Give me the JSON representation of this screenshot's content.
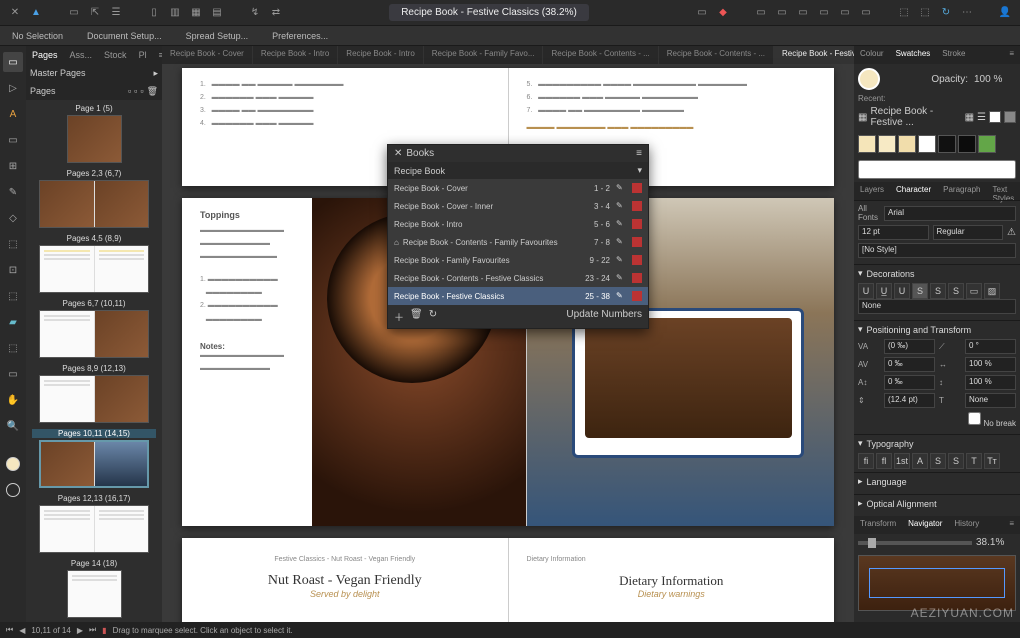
{
  "toolbar": {
    "doc_title": "Recipe Book - Festive Classics (38.2%)"
  },
  "menubar": {
    "items": [
      "No Selection",
      "Document Setup...",
      "Spread Setup...",
      "Preferences..."
    ]
  },
  "pages_panel": {
    "tabs": [
      "Pages",
      "Ass...",
      "Stock",
      "Pl"
    ],
    "section1": "Master Pages",
    "section2": "Pages",
    "list": [
      {
        "label": "Page 1 (5)"
      },
      {
        "label": "Pages 2,3 (6,7)"
      },
      {
        "label": "Pages 4,5 (8,9)"
      },
      {
        "label": "Pages 6,7 (10,11)"
      },
      {
        "label": "Pages 8,9 (12,13)"
      },
      {
        "label": "Pages 10,11 (14,15)"
      },
      {
        "label": "Pages 12,13 (16,17)"
      },
      {
        "label": "Page 14 (18)"
      }
    ]
  },
  "spread_tabs": [
    "Recipe Book - Cover",
    "Recipe Book - Intro",
    "Recipe Book - Intro",
    "Recipe Book - Family Favo...",
    "Recipe Book - Contents - ...",
    "Recipe Book - Contents - ...",
    "Recipe Book - Festive Clas..."
  ],
  "canvas": {
    "toppings_heading": "Toppings",
    "notes_heading": "Notes:",
    "bread_small": "Festive Classics - Nut Roast - Vegan Friendly",
    "bread_small_r": "Dietary Information",
    "caption_left": "Nut Roast - Vegan Friendly",
    "caption_right": "Dietary Information",
    "script_left": "Served by delight",
    "script_right": "Dietary warnings"
  },
  "book_panel": {
    "title": "Books",
    "selector": "Recipe Book",
    "rows": [
      {
        "name": "Recipe Book - Cover",
        "range": "1 - 2"
      },
      {
        "name": "Recipe Book - Cover - Inner",
        "range": "3 - 4"
      },
      {
        "name": "Recipe Book - Intro",
        "range": "5 - 6"
      },
      {
        "name": "Recipe Book - Contents - Family Favourites",
        "range": "7 - 8"
      },
      {
        "name": "Recipe Book - Family Favourites",
        "range": "9 - 22"
      },
      {
        "name": "Recipe Book - Contents - Festive Classics",
        "range": "23 - 24"
      },
      {
        "name": "Recipe Book - Festive Classics",
        "range": "25 - 38"
      }
    ],
    "update_btn": "Update Numbers"
  },
  "right": {
    "tabs1": [
      "Colour",
      "Swatches",
      "Stroke"
    ],
    "opacity_label": "Opacity:",
    "opacity_val": "100 %",
    "recent_label": "Recent:",
    "doc_swatches": "Recipe Book - Festive ...",
    "search_ph": "",
    "tabs2": [
      "Layers",
      "Character",
      "Paragraph",
      "Text Styles"
    ],
    "font_label": "All Fonts",
    "font_val": "Arial",
    "size_val": "12 pt",
    "weight_val": "Regular",
    "style_label": "[No Style]",
    "decorations": "Decorations",
    "dec_none": "None",
    "postrans": "Positioning and Transform",
    "pt_v1": "(0 ‰)",
    "pt_v2": "0 ‰",
    "pt_v3": "0 ‰",
    "pt_v4": "100 %",
    "pt_v5": "(12.4 pt)",
    "pt_v6": "None",
    "pt_r1": "0 °",
    "pt_r2": "100 %",
    "pt_r3": "100 %",
    "nobreak": "No break",
    "typography": "Typography",
    "language": "Language",
    "optical": "Optical Alignment",
    "tabs3": [
      "Transform",
      "Navigator",
      "History"
    ],
    "zoom": "38.1%"
  },
  "status": {
    "page_pos": "10,11 of 14",
    "hint": "Drag to marquee select. Click an object to select it."
  },
  "watermark": "AEZIYUAN.COM"
}
